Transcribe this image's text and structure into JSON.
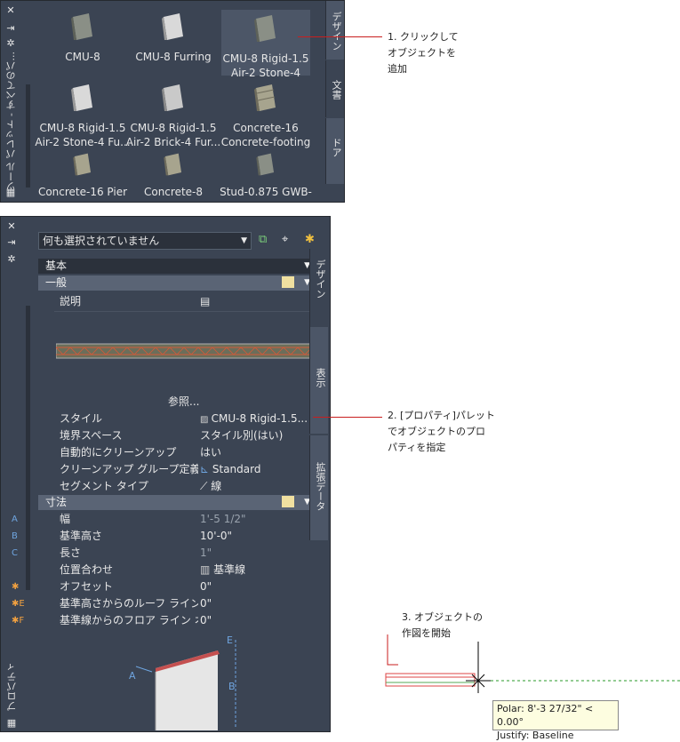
{
  "tool_palette": {
    "title": "ツール パレット - すべてのパ...",
    "tools": [
      {
        "label": "CMU-8",
        "selected": false
      },
      {
        "label": "CMU-8 Furring",
        "selected": false
      },
      {
        "label": "CMU-8 Rigid-1.5\nAir-2 Stone-4",
        "line1": "CMU-8 Rigid-1.5",
        "line2": "Air-2 Stone-4",
        "selected": true
      },
      {
        "line1": "CMU-8 Rigid-1.5",
        "line2": "Air-2 Stone-4 Fu...",
        "selected": false
      },
      {
        "line1": "CMU-8 Rigid-1.5",
        "line2": "Air-2 Brick-4 Fur...",
        "selected": false
      },
      {
        "line1": "Concrete-16",
        "line2": "Concrete-footing",
        "selected": false
      },
      {
        "label": "Concrete-16 Pier",
        "selected": false
      },
      {
        "label": "Concrete-8",
        "selected": false
      },
      {
        "label": "Stud-0.875 GWB-",
        "selected": false
      }
    ],
    "tabs": [
      "デザイン",
      "文書",
      "ドア"
    ]
  },
  "properties_palette": {
    "title": "プロパティ",
    "selection_dropdown": "何も選択されていません",
    "tabs": [
      "デザイン",
      "表示",
      "拡張データ"
    ],
    "section_basic": "基本",
    "section_general": "一般",
    "general_rows": [
      {
        "key": "説明",
        "value": ""
      }
    ],
    "browse_label": "参照...",
    "style_rows": [
      {
        "key": "スタイル",
        "value": "CMU-8 Rigid-1.5..."
      },
      {
        "key": "境界スペース",
        "value": "スタイル別(はい)"
      },
      {
        "key": "自動的にクリーンアップ",
        "value": "はい"
      },
      {
        "key": "クリーンアップ グループ定義",
        "value": "Standard"
      },
      {
        "key": "セグメント タイプ",
        "value": "線"
      }
    ],
    "section_dimensions": "寸法",
    "dimension_rows": [
      {
        "marker": "A",
        "key": "幅",
        "value": "1'-5 1/2\"",
        "dim": true
      },
      {
        "marker": "B",
        "key": "基準高さ",
        "value": "10'-0\"",
        "dim": false
      },
      {
        "marker": "C",
        "key": "長さ",
        "value": "1\"",
        "dim": true
      },
      {
        "marker": "",
        "key": "位置合わせ",
        "value": "基準線",
        "dim": false
      },
      {
        "marker": "✱",
        "key": "オフセット",
        "value": "0\"",
        "dim": false
      },
      {
        "marker": "✱E",
        "key": "基準高さからのルーフ ライン オ...",
        "value": "0\"",
        "dim": false
      },
      {
        "marker": "✱F",
        "key": "基準線からのフロア ライン オフ...",
        "value": "0\"",
        "dim": false
      }
    ],
    "diagram_labels": [
      "E",
      "A",
      "B"
    ]
  },
  "annotations": {
    "note1": [
      "1. クリックして",
      "オブジェクトを",
      "追加"
    ],
    "note2": [
      "2. [プロパティ]パレット",
      "でオブジェクトのプロ",
      "パティを指定"
    ],
    "note3": [
      "3. オブジェクトの",
      "作図を開始"
    ]
  },
  "tooltip": {
    "line1": "Polar: 8'-3 27/32\" < 0.00°",
    "line2": "Justify: Baseline"
  },
  "colors": {
    "palette_bg": "#3b4453",
    "accent_red": "#c81e1e",
    "tooltip_bg": "#fdfde0"
  }
}
